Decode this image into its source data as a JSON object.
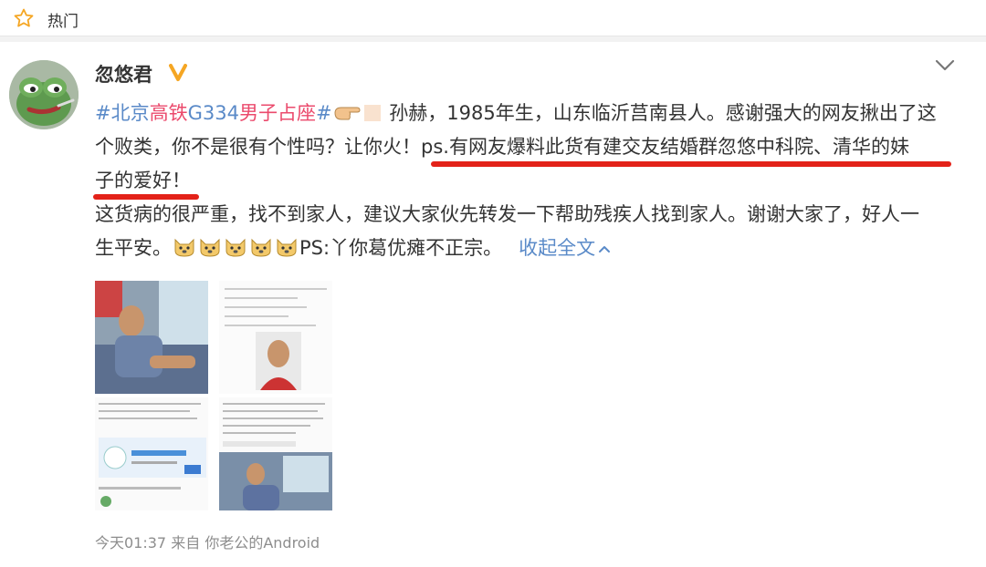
{
  "header": {
    "title": "热门"
  },
  "post": {
    "author": "忽悠君",
    "topic_hash1": "#",
    "topic_a": "北京",
    "topic_b": "高铁",
    "topic_c": "G334",
    "topic_d": "男子",
    "topic_e": "占座",
    "topic_hash2": "#",
    "line1_text": "孙赫，1985年生，山东临沂莒南县人。感谢强大的网友揪出了这",
    "line2_text_a": "个败类，你不是很有个性吗？让你火！",
    "line2_text_b": "ps.有网友爆料此货有建交友结婚群忽悠中科院、清华的妹",
    "line3_text": "子的爱好！",
    "line4_text": "这货病的很严重，找不到家人，建议大家伙先转发一下帮助残疾人找到家人。谢谢大家了，好人一",
    "line5_text": "生平安。",
    "line5_ps": "PS:丫你葛优瘫不正宗。",
    "collapse_label": "收起全文",
    "timestamp": "今天01:37",
    "source_prefix": "来自",
    "source": "你老公的Android"
  },
  "icons": [
    "star-icon",
    "verified-badge-icon",
    "chevron-down-icon",
    "pointing-hand-emoji",
    "doge-emoji"
  ],
  "colors": {
    "topic": "#5a8ac8",
    "topic_highlight": "#eb4a6c",
    "underline": "#e32219",
    "badge": "#f5a623"
  }
}
